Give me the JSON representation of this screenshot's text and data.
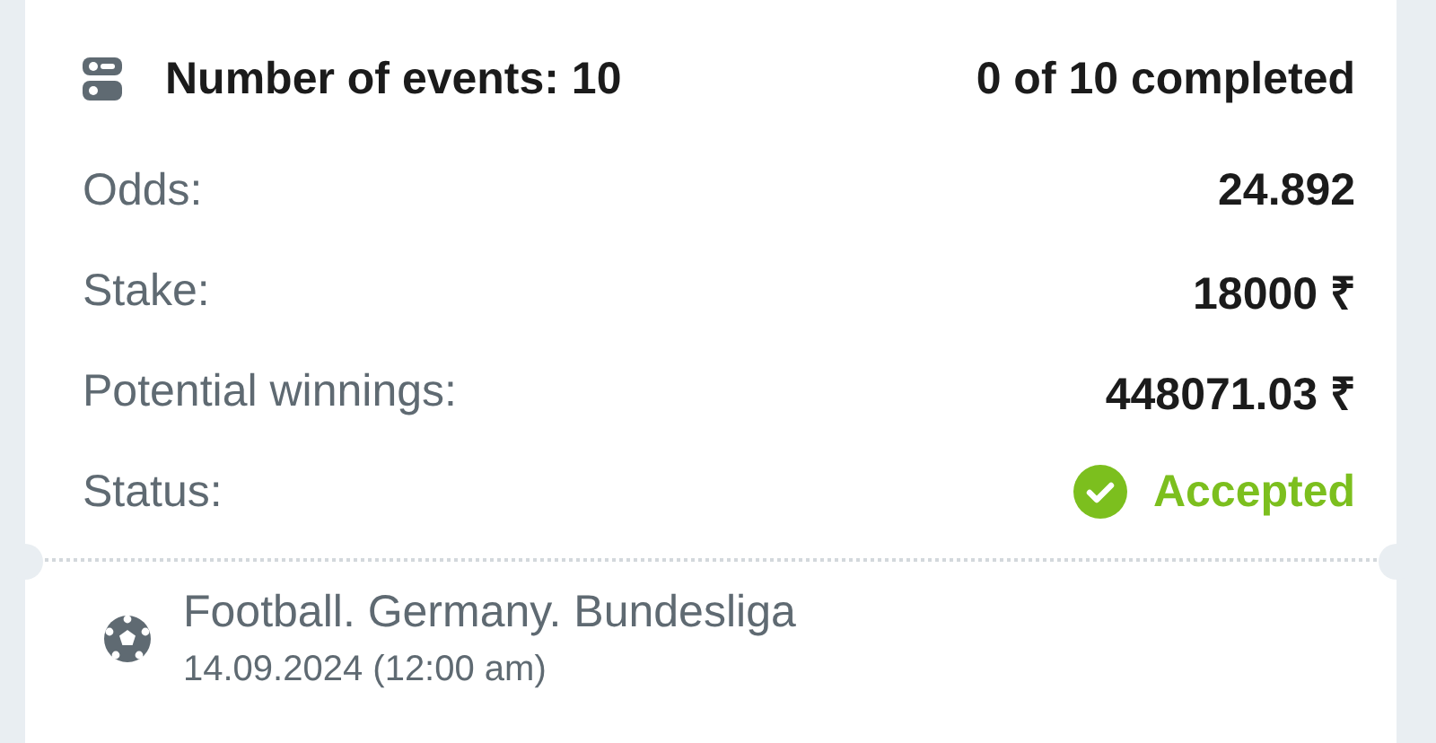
{
  "summary": {
    "events_label": "Number of events: 10",
    "progress": "0 of 10 completed"
  },
  "details": [
    {
      "label": "Odds:",
      "value": "24.892"
    },
    {
      "label": "Stake:",
      "value": "18000 ₹"
    },
    {
      "label": "Potential winnings:",
      "value": "448071.03 ₹"
    }
  ],
  "status": {
    "label": "Status:",
    "value": "Accepted",
    "kind": "accepted"
  },
  "event": {
    "title": "Football. Germany. Bundesliga",
    "date": "14.09.2024 (12:00 am)"
  }
}
